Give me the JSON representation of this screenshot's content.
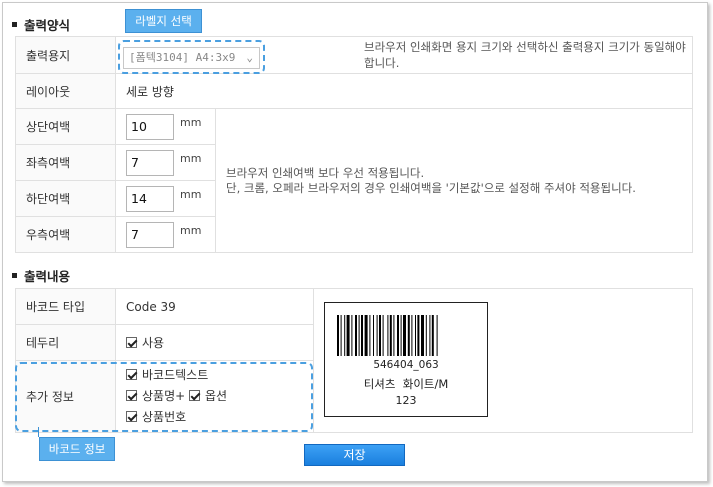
{
  "output_format": {
    "section_title": "출력양식",
    "paper_label": "출력용지",
    "paper_select_value": "[폼텍3104] A4:3x9",
    "paper_note": "브라우저 인쇄화면 용지 크기와 선택하신 출력용지 크기가 동일해야 합니다.",
    "layout_label": "레이아웃",
    "layout_value": "세로 방향",
    "top_margin_label": "상단여백",
    "top_margin_value": "10",
    "left_margin_label": "좌측여백",
    "left_margin_value": "7",
    "bottom_margin_label": "하단여백",
    "bottom_margin_value": "14",
    "right_margin_label": "우측여백",
    "right_margin_value": "7",
    "unit": "mm",
    "margin_note_line1": "브라우저 인쇄여백 보다 우선 적용됩니다.",
    "margin_note_line2": "단, 크롬, 오페라 브라우저의 경우 인쇄여백을 '기본값'으로 설정해 주셔야 적용됩니다."
  },
  "label_select_tag": "라벨지 선택",
  "output_content": {
    "section_title": "출력내용",
    "barcode_type_label": "바코드 타입",
    "barcode_type_value": "Code 39",
    "border_label": "테두리",
    "border_use_label": "사용",
    "extra_info_label": "추가 정보",
    "opt_barcode_text": "바코드텍스트",
    "opt_product_name": "상품명+",
    "opt_option": "옵션",
    "opt_product_number": "상품번호"
  },
  "barcode_info_tag": "바코드 정보",
  "preview": {
    "barcode_number": "546404_063",
    "product_line": "티셔츠  화이트/M",
    "product_number": "123"
  },
  "save_label": "저장"
}
